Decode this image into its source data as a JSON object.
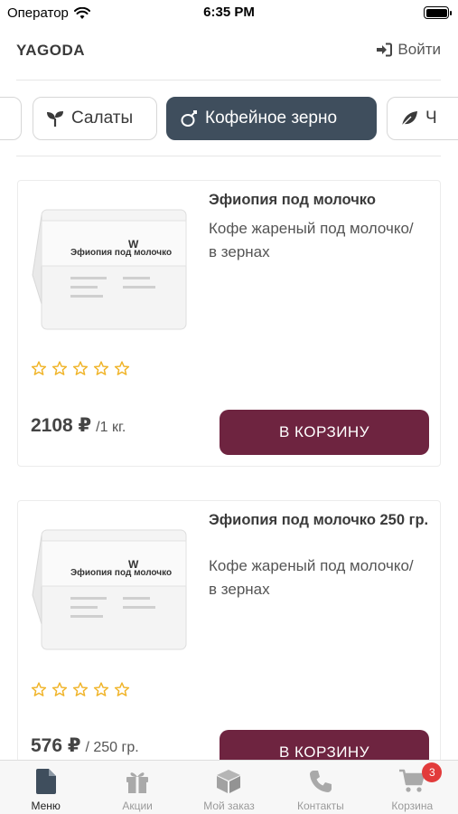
{
  "status_bar": {
    "carrier": "Оператор",
    "time": "6:35 PM"
  },
  "header": {
    "brand": "YAGODA",
    "login_label": "Войти"
  },
  "categories": [
    {
      "label": "",
      "icon": "chip-partial-left"
    },
    {
      "label": "Салаты",
      "icon": "sprout-icon"
    },
    {
      "label": "Кофейное зерно",
      "icon": "coffee-bean-icon",
      "active": true
    },
    {
      "label": "Ч",
      "icon": "leaf-icon"
    }
  ],
  "products": [
    {
      "title": "Эфиопия под молочко",
      "description": "Кофе жареный под молочко/в зернах",
      "rating": 0,
      "max_rating": 5,
      "price": "2108 ₽",
      "unit": "/1 кг.",
      "button_label": "В КОРЗИНУ",
      "package_text": "Эфиопия под молочко"
    },
    {
      "title": "Эфиопия под молочко 250 гр.",
      "description": "Кофе жареный под молочко/в зернах",
      "rating": 0,
      "max_rating": 5,
      "price": "576 ₽",
      "unit": "/ 250 гр.",
      "button_label": "В КОРЗИНУ",
      "package_text": "Эфиопия под молочко"
    }
  ],
  "tabbar": [
    {
      "label": "Меню",
      "icon": "document-icon",
      "active": true
    },
    {
      "label": "Акции",
      "icon": "gift-icon"
    },
    {
      "label": "Мой заказ",
      "icon": "box-icon"
    },
    {
      "label": "Контакты",
      "icon": "phone-icon"
    },
    {
      "label": "Корзина",
      "icon": "cart-icon",
      "badge": "3"
    }
  ],
  "colors": {
    "accent_button": "#6e2440",
    "active_chip": "#3f4e5d",
    "star": "#f0b429",
    "badge": "#e23b3b"
  }
}
